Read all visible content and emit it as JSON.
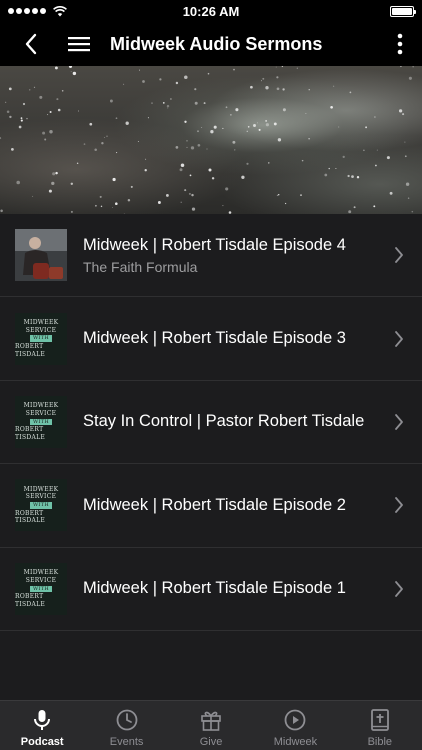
{
  "status_bar": {
    "time": "10:26 AM"
  },
  "nav": {
    "title": "Midweek Audio Sermons"
  },
  "items": [
    {
      "title": "Midweek | Robert Tisdale Episode 4",
      "subtitle": "The Faith Formula",
      "thumb": "photo"
    },
    {
      "title": "Midweek |  Robert Tisdale Episode 3",
      "subtitle": "",
      "thumb": "graphic"
    },
    {
      "title": "Stay In Control | Pastor Robert Tisdale",
      "subtitle": "",
      "thumb": "graphic"
    },
    {
      "title": "Midweek | Robert Tisdale Episode 2",
      "subtitle": "",
      "thumb": "graphic"
    },
    {
      "title": "Midweek | Robert Tisdale Episode 1",
      "subtitle": "",
      "thumb": "graphic"
    }
  ],
  "thumb_graphic": {
    "line1": "MIDWEEK",
    "line2": "SERVICE",
    "line3": "WITH",
    "line4": "ROBERT TISDALE"
  },
  "tabs": [
    {
      "label": "Podcast",
      "icon": "microphone-icon",
      "active": true
    },
    {
      "label": "Events",
      "icon": "clock-icon",
      "active": false
    },
    {
      "label": "Give",
      "icon": "gift-icon",
      "active": false
    },
    {
      "label": "Midweek",
      "icon": "play-circle-icon",
      "active": false
    },
    {
      "label": "Bible",
      "icon": "bible-icon",
      "active": false
    }
  ],
  "colors": {
    "background": "#1c1c1e",
    "bar": "#000000",
    "tab_bar": "#2a2a2c",
    "subtitle": "#9d9d9f",
    "thumb_accent": "#6fc2a8"
  }
}
